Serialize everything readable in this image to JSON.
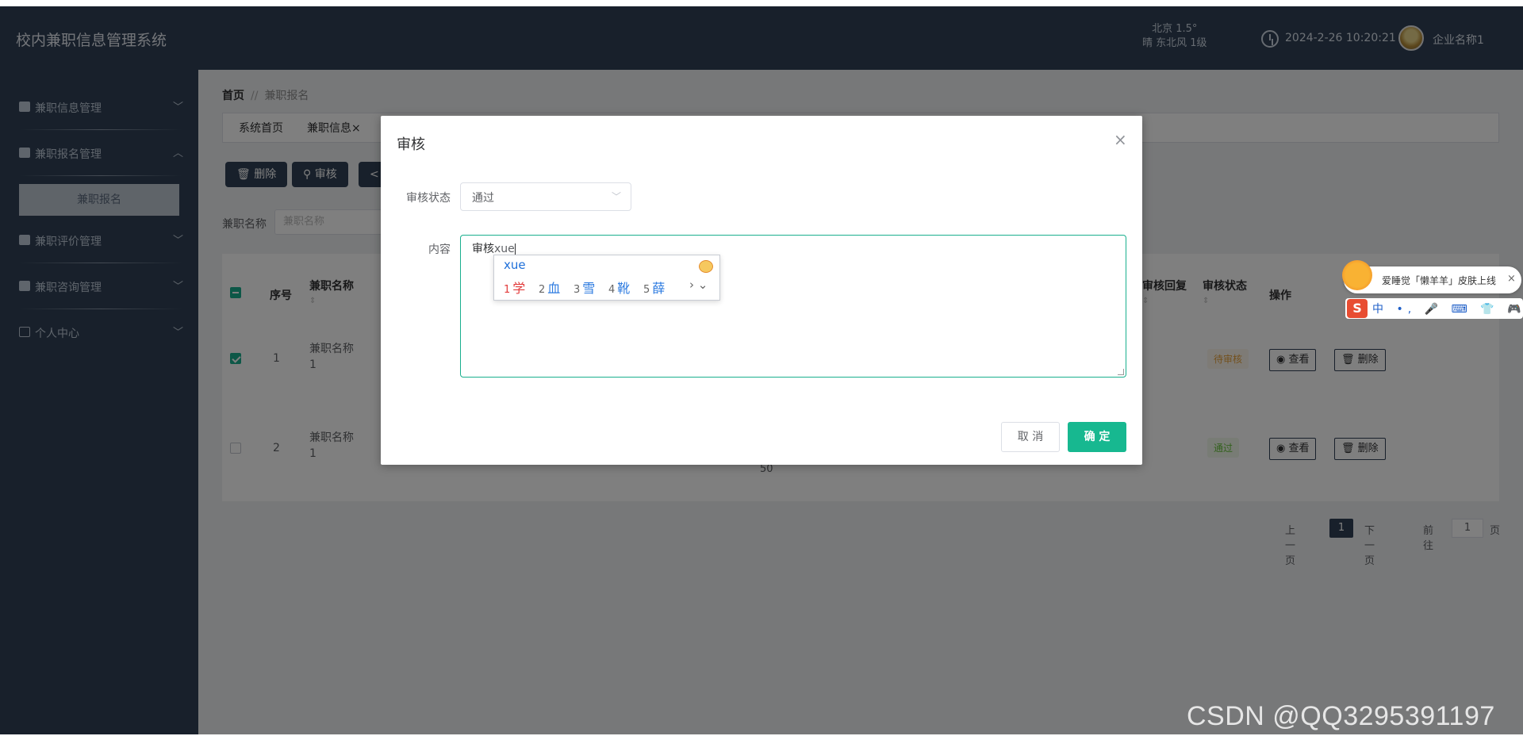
{
  "header": {
    "title": "校内兼职信息管理系统",
    "weather_line1": "北京 1.5°",
    "weather_line2": "晴 东北风 1级",
    "datetime": "2024-2-26 10:20:21",
    "company": "企业名称1"
  },
  "sidebar": {
    "items": [
      {
        "label": "兼职信息管理",
        "chev": "﹀"
      },
      {
        "label": "兼职报名管理",
        "chev": "︿"
      },
      {
        "label": "兼职评价管理",
        "chev": "﹀"
      },
      {
        "label": "兼职咨询管理",
        "chev": "﹀"
      },
      {
        "label": "个人中心",
        "chev": "﹀"
      }
    ],
    "sub_item": "兼职报名"
  },
  "breadcrumb": {
    "home": "首页",
    "sep": "//",
    "current": "兼职报名"
  },
  "tabs": [
    "系统首页",
    "兼职信息×"
  ],
  "toolbar": {
    "delete": "🗑 删除",
    "audit": "⚲ 审核",
    "share": "<"
  },
  "search": {
    "label": "兼职名称",
    "placeholder": "兼职名称"
  },
  "table": {
    "headers": {
      "index": "序号",
      "name": "兼职名称",
      "reply": "审核回复",
      "status": "审核状态",
      "ops": "操作",
      "sort": "⇕"
    },
    "rows": [
      {
        "index": "1",
        "name": "兼职名称\n1",
        "status": "待审核",
        "view": "◉ 查看",
        "delete": "🗑 删除"
      },
      {
        "index": "2",
        "name": "兼职名称\n1",
        "status": "通过",
        "view": "◉ 查看",
        "delete": "🗑 删除"
      }
    ],
    "stray_value": "50"
  },
  "pager": {
    "prev": "上一页",
    "page": "1",
    "next": "下一页",
    "goto": "前往",
    "goto_value": "1",
    "unit": "页"
  },
  "dialog": {
    "title": "审核",
    "close": "×",
    "status_label": "审核状态",
    "status_value": "通过",
    "select_arrow": "﹀",
    "content_label": "内容",
    "content_text": "审核",
    "composition": "xue",
    "cancel": "取 消",
    "confirm": "确 定"
  },
  "ime_popup": {
    "pinyin": "xue",
    "candidates": [
      {
        "num": "1",
        "text": "学"
      },
      {
        "num": "2",
        "text": "血"
      },
      {
        "num": "3",
        "text": "雪"
      },
      {
        "num": "4",
        "text": "靴"
      },
      {
        "num": "5",
        "text": "薛"
      }
    ],
    "more": "› ⌄"
  },
  "sogou": {
    "bubble_text": "爱睡觉「懒羊羊」皮肤上线",
    "close": "×",
    "logo": "S",
    "toolbar": "中 •, 🎤 ⌨ 👕 🎮 ▦ ⚙"
  },
  "watermark": "CSDN @QQ3295391197"
}
